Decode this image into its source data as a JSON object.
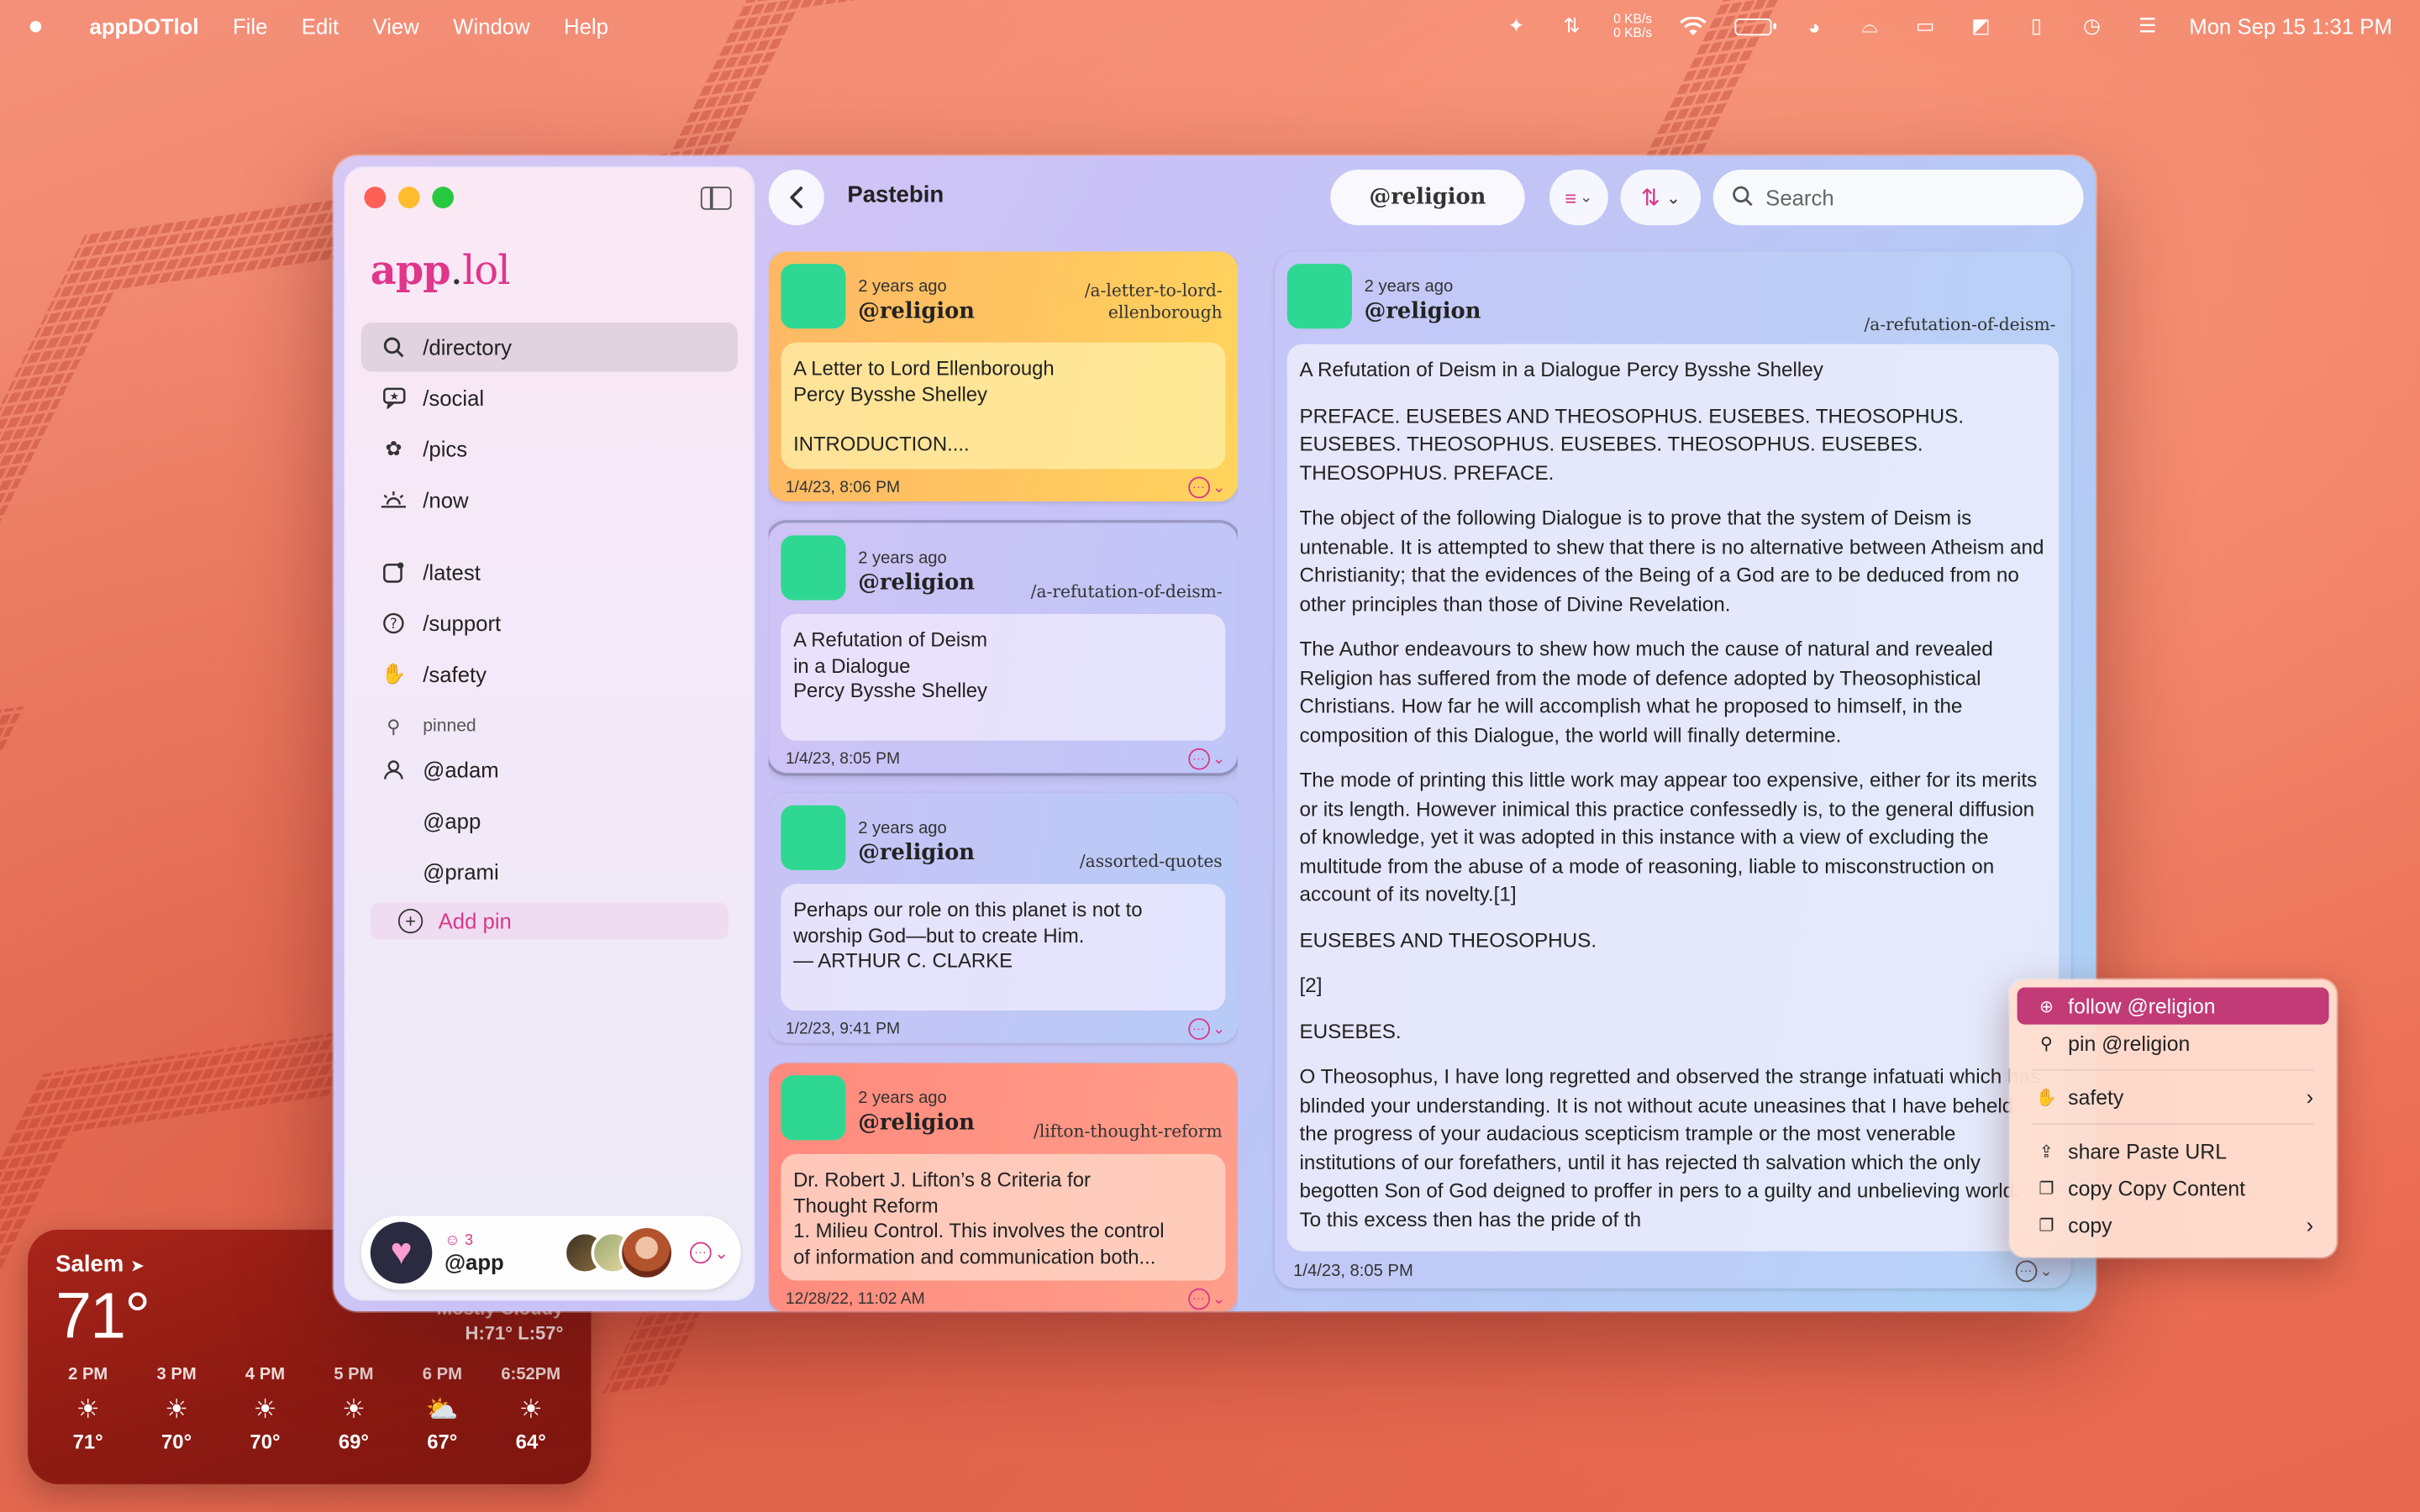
{
  "menubar": {
    "app_name": "appDOTlol",
    "menus": [
      "File",
      "Edit",
      "View",
      "Window",
      "Help"
    ],
    "net_up": "0 KB/s",
    "net_down": "0 KB/s",
    "datetime": "Mon Sep 15  1:31 PM"
  },
  "sidebar": {
    "logo_app": "app",
    "logo_dot": ".",
    "logo_lol": "lol",
    "nav": [
      {
        "label": "/directory",
        "icon": "magnifier-icon"
      },
      {
        "label": "/social",
        "icon": "speech-bubble-icon"
      },
      {
        "label": "/pics",
        "icon": "flower-icon"
      },
      {
        "label": "/now",
        "icon": "sunrise-icon"
      },
      {
        "label": "/latest",
        "icon": "new-badge-icon"
      },
      {
        "label": "/support",
        "icon": "question-icon"
      },
      {
        "label": "/safety",
        "icon": "hand-icon"
      }
    ],
    "pinned_header": "pinned",
    "pinned": [
      "@adam",
      "@app",
      "@prami"
    ],
    "add_pin": "Add pin"
  },
  "account": {
    "count": "3",
    "name": "@app"
  },
  "toolbar": {
    "title": "Pastebin",
    "scope": "@religion",
    "search_placeholder": "Search"
  },
  "feed": [
    {
      "time": "2 years ago",
      "user": "@religion",
      "slug": "/a-letter-to-lord-ellenborough",
      "body_lines": [
        "A Letter to Lord Ellenborough",
        "Percy Bysshe Shelley",
        "",
        "INTRODUCTION...."
      ],
      "date": "1/4/23, 8:06 PM",
      "color": "#ffc561"
    },
    {
      "time": "2 years ago",
      "user": "@religion",
      "slug": "/a-refutation-of-deism-",
      "body_lines": [
        "A Refutation of Deism",
        "in a Dialogue",
        "Percy Bysshe Shelley"
      ],
      "date": "1/4/23, 8:05 PM",
      "color": "#cfc3f5"
    },
    {
      "time": "2 years ago",
      "user": "@religion",
      "slug": "/assorted-quotes",
      "body_lines": [
        "Perhaps our role on this planet is not to",
        "worship God—but to create Him.",
        "— ARTHUR C. CLARKE"
      ],
      "date": "1/2/23, 9:41 PM",
      "color": "#c8c3f5"
    },
    {
      "time": "2 years ago",
      "user": "@religion",
      "slug": "/lifton-thought-reform",
      "body_lines": [
        "Dr. Robert J. Lifton’s 8 Criteria for",
        "Thought Reform",
        "1. Milieu Control. This involves the control",
        "of information and communication both..."
      ],
      "date": "12/28/22, 11:02 AM",
      "color": "#ff8a7d"
    }
  ],
  "detail": {
    "time": "2 years ago",
    "user": "@religion",
    "slug": "/a-refutation-of-deism-",
    "paragraphs": [
      "A Refutation of Deism in a Dialogue Percy Bysshe Shelley",
      "PREFACE. EUSEBES AND THEOSOPHUS. EUSEBES. THEOSOPHUS. EUSEBES. THEOSOPHUS. EUSEBES. THEOSOPHUS. EUSEBES. THEOSOPHUS. PREFACE.",
      "The object of the following Dialogue is to prove that the system of Deism is untenable. It is attempted to shew that there is no alternative between Atheism and Christianity; that the evidences of the Being of a God are to be deduced from no other principles than those of Divine Revelation.",
      "The Author endeavours to shew how much the cause of natural and revealed Religion has suffered from the mode of defence adopted by Theosophistical Christians. How far he will accomplish what he proposed to himself, in the composition of this Dialogue, the world will finally determine.",
      "The mode of printing this little work may appear too expensive, either for its merits or its length. However inimical this practice confessedly is, to the general diffusion of knowledge, yet it was adopted in this instance with a view of excluding the multitude from the abuse of a mode of reasoning, liable to misconstruction on account of its novelty.[1]",
      "EUSEBES AND THEOSOPHUS.",
      "[2]",
      "EUSEBES.",
      "O Theosophus, I have long regretted and observed the strange infatuati which has blinded your understanding. It is not without acute uneasines that I have beheld the progress of your audacious scepticism trample or the most venerable institutions of our forefathers, until it has rejected th salvation which the only begotten Son of God deigned to proffer in pers to a guilty and unbelieving world. To this excess then has the pride of th"
    ],
    "date": "1/4/23, 8:05 PM"
  },
  "context_menu": {
    "items": [
      {
        "label": "follow @religion",
        "icon": "plus-circle-icon"
      },
      {
        "label": "pin @religion",
        "icon": "pin-icon"
      },
      {
        "label": "safety",
        "icon": "hand-icon"
      },
      {
        "label": "share Paste URL",
        "icon": "share-icon"
      },
      {
        "label": "copy Copy Content",
        "icon": "copy-icon"
      },
      {
        "label": "copy",
        "icon": "copy-icon"
      }
    ]
  },
  "weather": {
    "city": "Salem",
    "temp": "71°",
    "condition": "Mostly Cloudy",
    "high_low": "H:71° L:57°",
    "hours": [
      {
        "time": "2 PM",
        "icon": "sun-icon",
        "temp": "71°"
      },
      {
        "time": "3 PM",
        "icon": "sun-icon",
        "temp": "70°"
      },
      {
        "time": "4 PM",
        "icon": "sun-icon",
        "temp": "70°"
      },
      {
        "time": "5 PM",
        "icon": "sun-icon",
        "temp": "69°"
      },
      {
        "time": "6 PM",
        "icon": "partly-cloudy-icon",
        "temp": "67°"
      },
      {
        "time": "6:52PM",
        "icon": "sunset-icon",
        "temp": "64°"
      }
    ]
  },
  "colors": {
    "accent": "#d63a8a",
    "highlight": "#c23a76",
    "avatar_green": "#2fd892"
  }
}
